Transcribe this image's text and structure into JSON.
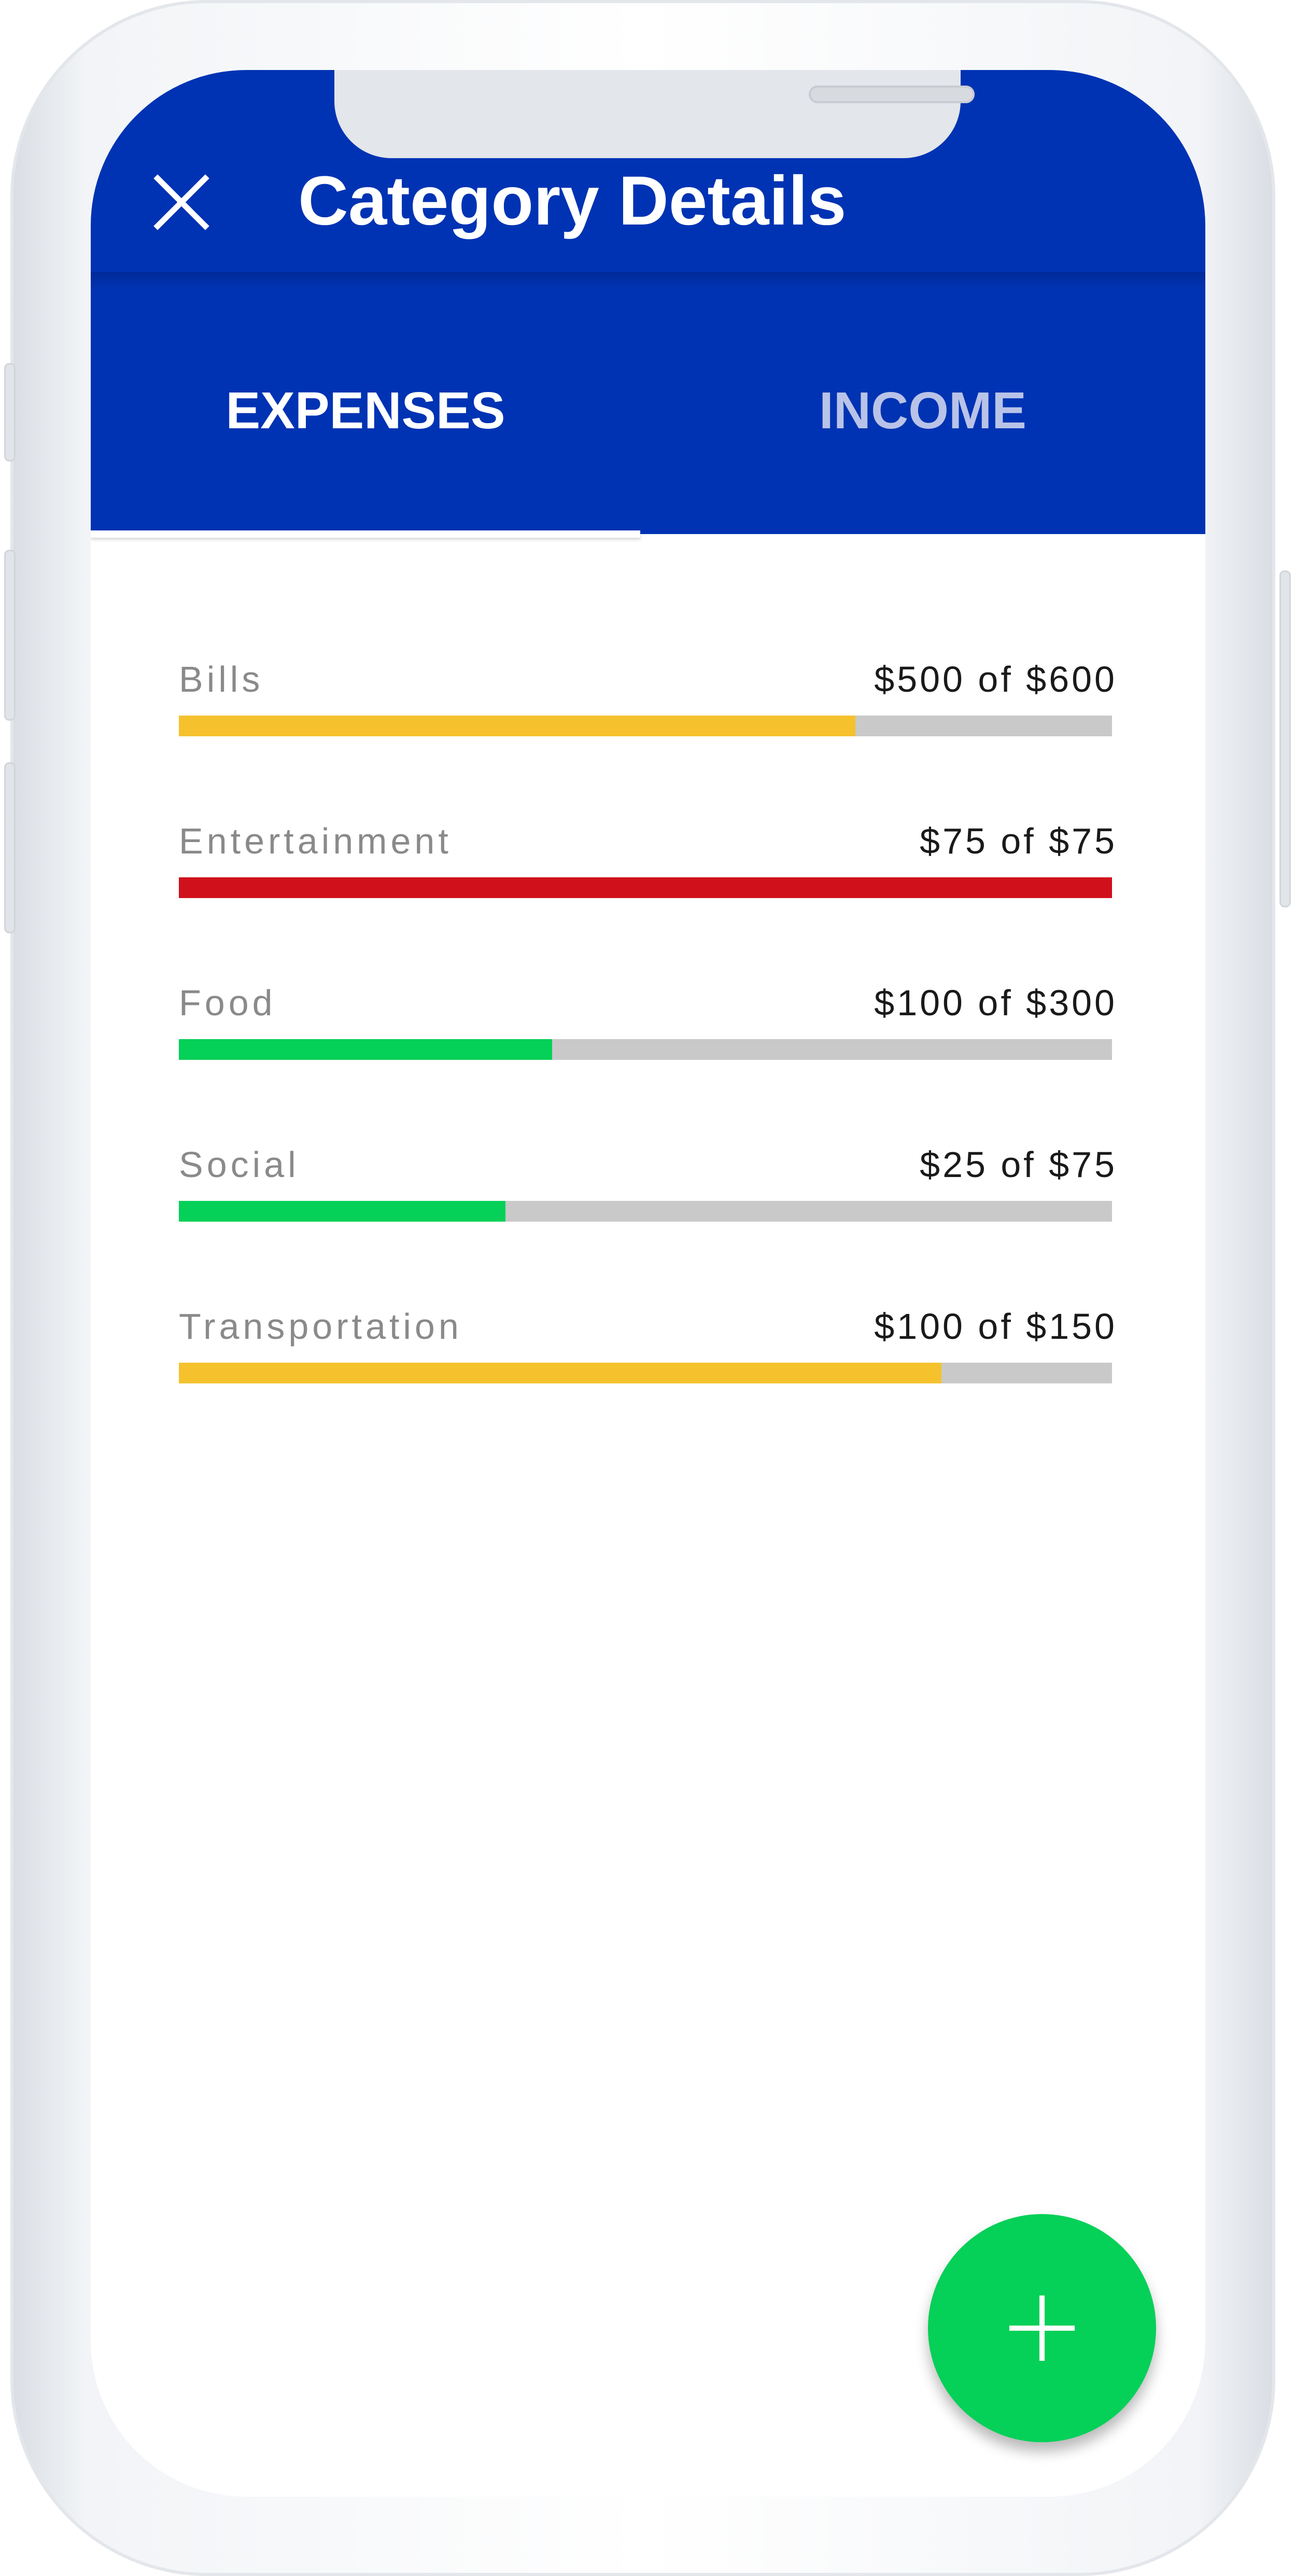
{
  "header": {
    "title": "Category Details",
    "close_icon": "close-icon"
  },
  "tabs": [
    {
      "label": "EXPENSES",
      "active": true
    },
    {
      "label": "INCOME",
      "active": false
    }
  ],
  "categories": [
    {
      "name": "Bills",
      "amount": "$500 of $600",
      "progress": 0.725,
      "color": "#f5c22e"
    },
    {
      "name": "Entertainment",
      "amount": "$75 of $75",
      "progress": 1.0,
      "color": "#d0111b"
    },
    {
      "name": "Food",
      "amount": "$100 of $300",
      "progress": 0.4,
      "color": "#05d057"
    },
    {
      "name": "Social",
      "amount": "$25 of $75",
      "progress": 0.35,
      "color": "#05d057"
    },
    {
      "name": "Transportation",
      "amount": "$100 of $150",
      "progress": 0.817,
      "color": "#f5c22e"
    }
  ],
  "fab": {
    "icon": "plus-icon",
    "color": "#05d057"
  },
  "colors": {
    "primary": "#0033b3",
    "track": "#c9c9c9"
  }
}
